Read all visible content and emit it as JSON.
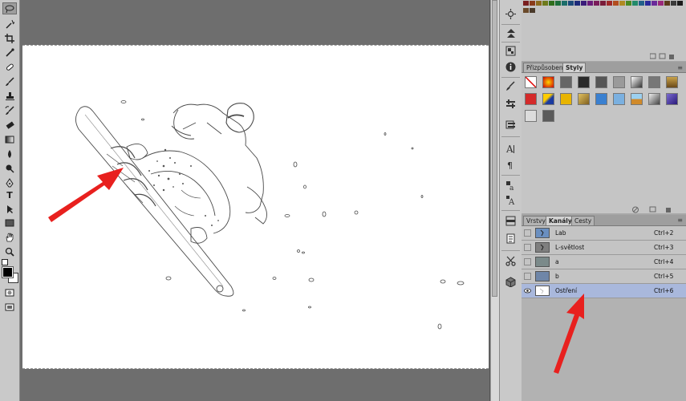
{
  "toolbar": {
    "tools": [
      "lasso-icon",
      "magic-wand-icon",
      "crop-icon",
      "eyedropper-icon",
      "healing-brush-icon",
      "brush-icon",
      "clone-stamp-icon",
      "history-brush-icon",
      "eraser-icon",
      "gradient-icon",
      "blur-icon",
      "dodge-icon",
      "pen-icon",
      "type-icon",
      "path-selection-icon",
      "shape-icon",
      "hand-icon",
      "zoom-icon"
    ],
    "type_glyph": "T"
  },
  "styles_panel": {
    "tabs": [
      "Přizpůsobení",
      "Styly"
    ],
    "active_tab": "Styly"
  },
  "channels_panel": {
    "tabs": [
      "Vrstvy",
      "Kanály",
      "Cesty"
    ],
    "active_tab": "Kanály",
    "rows": [
      {
        "name": "Lab",
        "shortcut": "Ctrl+2",
        "thumb_color": "#6a8fc0",
        "visible": false
      },
      {
        "name": "L-světlost",
        "shortcut": "Ctrl+3",
        "thumb_color": "#7f7f7f",
        "visible": false
      },
      {
        "name": "a",
        "shortcut": "Ctrl+4",
        "thumb_color": "#7b8a8a",
        "visible": false
      },
      {
        "name": "b",
        "shortcut": "Ctrl+5",
        "thumb_color": "#6f86a8",
        "visible": false
      },
      {
        "name": "Ostření",
        "shortcut": "Ctrl+6",
        "thumb_color": "#ffffff",
        "visible": true,
        "selected": true
      }
    ]
  },
  "colors": {
    "arrow": "#e8201e",
    "selected_row": "#a9b8dc"
  }
}
